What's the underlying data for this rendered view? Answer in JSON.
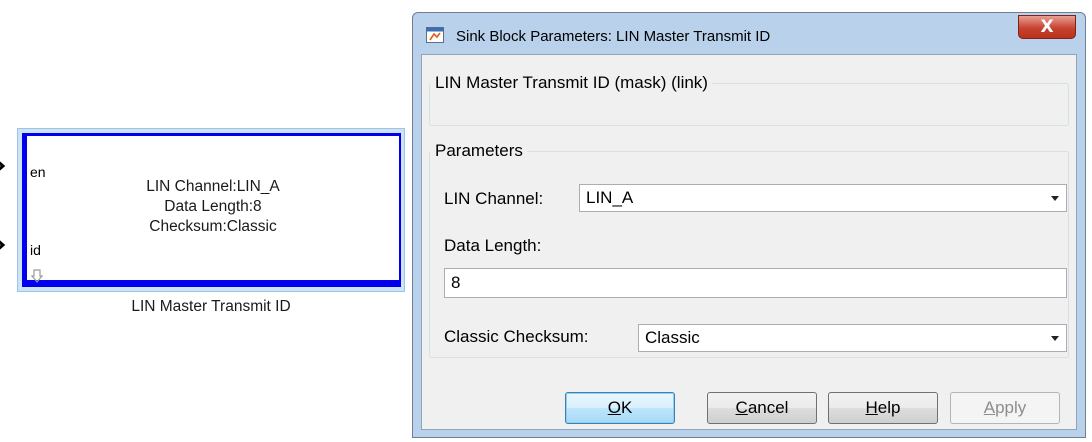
{
  "block": {
    "port_en": "en",
    "port_id": "id",
    "line1": "LIN Channel:LIN_A",
    "line2": "Data Length:8",
    "line3": "Checksum:Classic",
    "name": "LIN Master Transmit ID"
  },
  "dialog": {
    "title": "Sink Block Parameters: LIN Master Transmit ID",
    "close_glyph": "X",
    "description_group": "LIN Master Transmit ID (mask) (link)",
    "parameters_group": "Parameters",
    "lin_channel_label": "LIN Channel:",
    "lin_channel_value": "LIN_A",
    "data_length_label": "Data Length:",
    "data_length_value": "8",
    "checksum_label": "Classic Checksum:",
    "checksum_value": "Classic",
    "buttons": {
      "ok_mnemonic": "O",
      "ok_rest": "K",
      "cancel_mnemonic": "C",
      "cancel_rest": "ancel",
      "help_mnemonic": "H",
      "help_rest": "elp",
      "apply_mnemonic": "A",
      "apply_rest": "pply"
    }
  },
  "colors": {
    "block_border": "#0000ee",
    "window_frame": "#b9d1ea",
    "close_button": "#c7432f"
  }
}
